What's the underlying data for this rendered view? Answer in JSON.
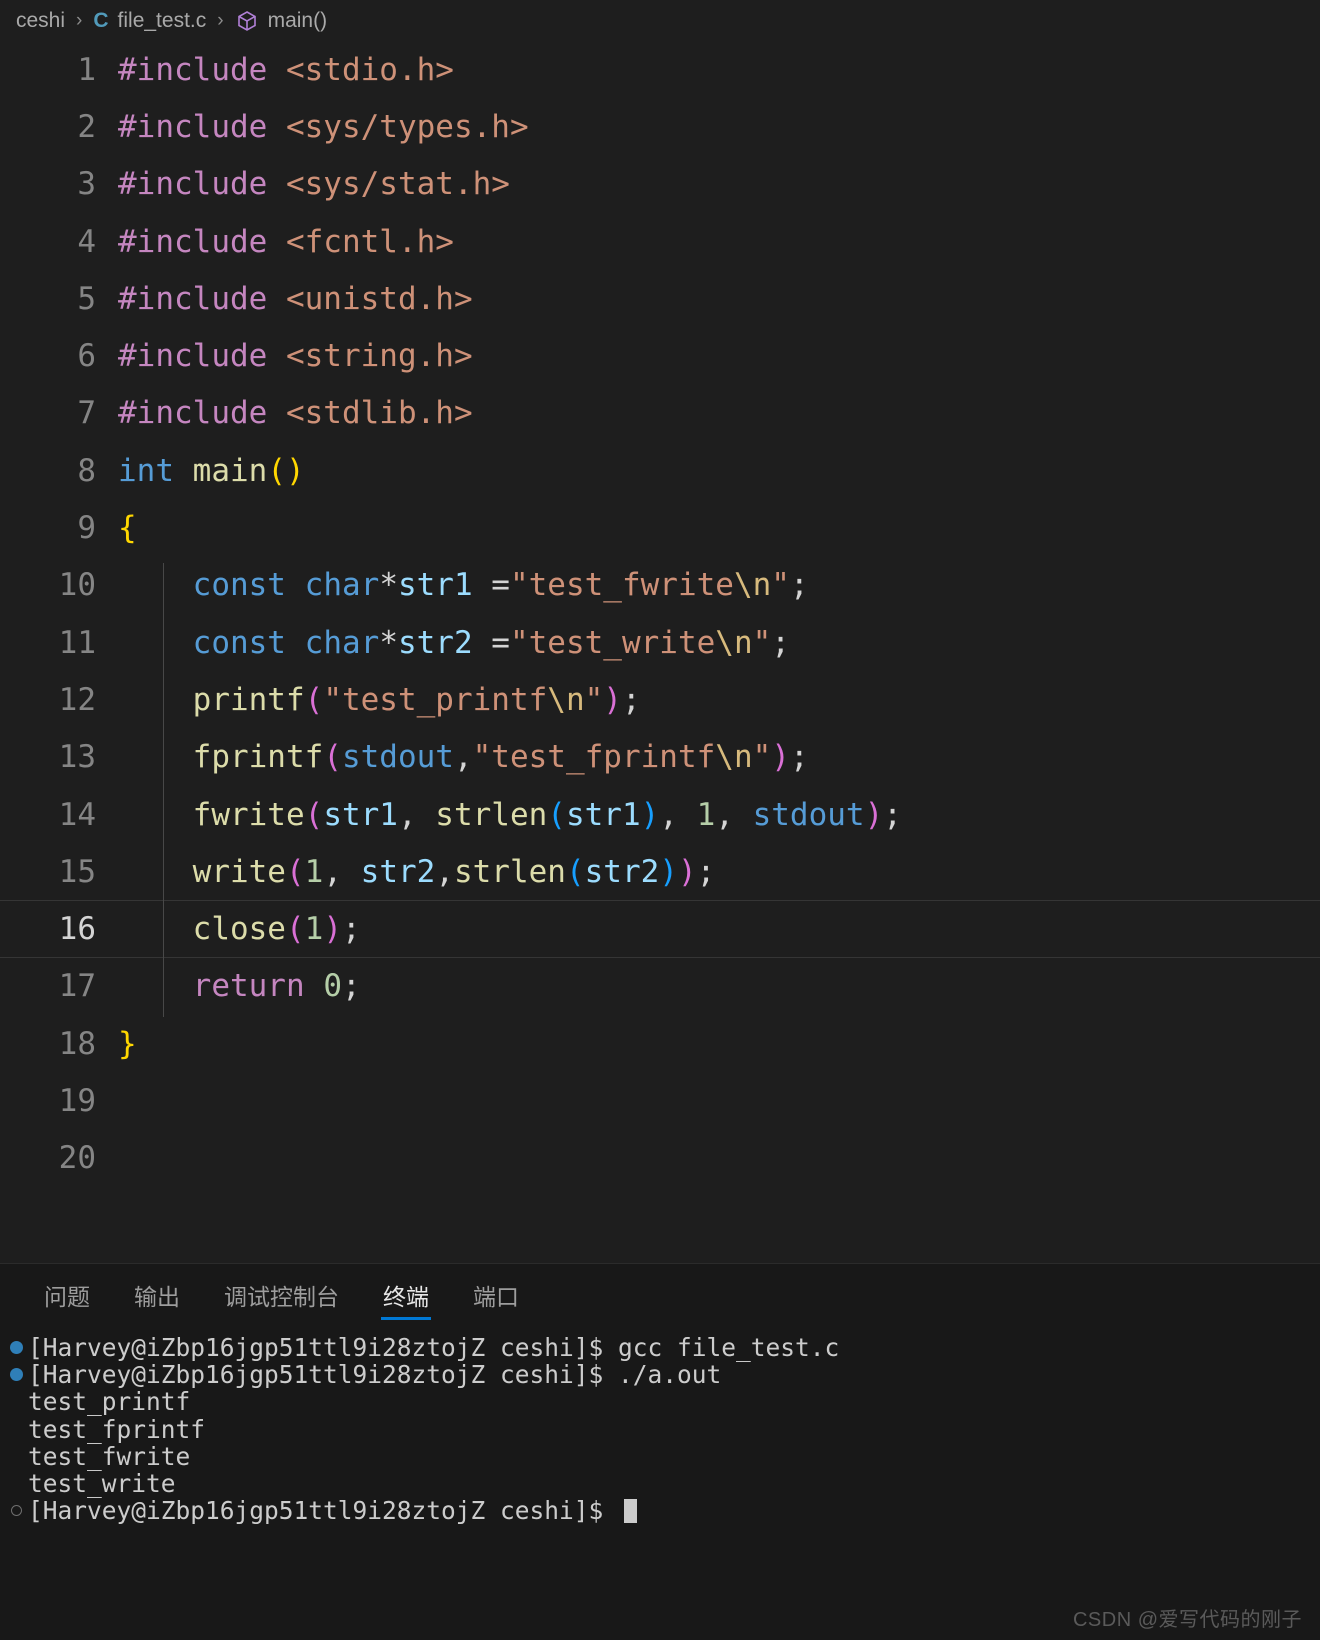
{
  "breadcrumb": {
    "items": [
      {
        "label": "ceshi",
        "icon": null
      },
      {
        "label": "file_test.c",
        "icon": "c-file-icon"
      },
      {
        "label": "main()",
        "icon": "symbol-cube-icon"
      }
    ],
    "separator": "›"
  },
  "editor": {
    "active_line": 16,
    "total_lines": 20,
    "lines": [
      {
        "n": "1",
        "tokens": [
          {
            "t": "#include",
            "c": "t-pre"
          },
          {
            "t": " ",
            "c": "t-plain"
          },
          {
            "t": "<stdio.h>",
            "c": "t-str"
          }
        ]
      },
      {
        "n": "2",
        "tokens": [
          {
            "t": "#include",
            "c": "t-pre"
          },
          {
            "t": " ",
            "c": "t-plain"
          },
          {
            "t": "<sys/types.h>",
            "c": "t-str"
          }
        ]
      },
      {
        "n": "3",
        "tokens": [
          {
            "t": "#include",
            "c": "t-pre"
          },
          {
            "t": " ",
            "c": "t-plain"
          },
          {
            "t": "<sys/stat.h>",
            "c": "t-str"
          }
        ]
      },
      {
        "n": "4",
        "tokens": [
          {
            "t": "#include",
            "c": "t-pre"
          },
          {
            "t": " ",
            "c": "t-plain"
          },
          {
            "t": "<fcntl.h>",
            "c": "t-str"
          }
        ]
      },
      {
        "n": "5",
        "tokens": [
          {
            "t": "#include",
            "c": "t-pre"
          },
          {
            "t": " ",
            "c": "t-plain"
          },
          {
            "t": "<unistd.h>",
            "c": "t-str"
          }
        ]
      },
      {
        "n": "6",
        "tokens": [
          {
            "t": "#include",
            "c": "t-pre"
          },
          {
            "t": " ",
            "c": "t-plain"
          },
          {
            "t": "<string.h>",
            "c": "t-str"
          }
        ]
      },
      {
        "n": "7",
        "tokens": [
          {
            "t": "#include",
            "c": "t-pre"
          },
          {
            "t": " ",
            "c": "t-plain"
          },
          {
            "t": "<stdlib.h>",
            "c": "t-str"
          }
        ]
      },
      {
        "n": "8",
        "tokens": [
          {
            "t": "int",
            "c": "t-key"
          },
          {
            "t": " ",
            "c": "t-plain"
          },
          {
            "t": "main",
            "c": "t-fn"
          },
          {
            "t": "()",
            "c": "t-br1"
          }
        ]
      },
      {
        "n": "9",
        "tokens": [
          {
            "t": "{",
            "c": "t-br1"
          }
        ]
      },
      {
        "n": "10",
        "tokens": [
          {
            "t": "    ",
            "c": "t-plain"
          },
          {
            "t": "const",
            "c": "t-key"
          },
          {
            "t": " ",
            "c": "t-plain"
          },
          {
            "t": "char",
            "c": "t-key"
          },
          {
            "t": "*",
            "c": "t-plain"
          },
          {
            "t": "str1",
            "c": "t-var"
          },
          {
            "t": " =",
            "c": "t-plain"
          },
          {
            "t": "\"test_fwrite",
            "c": "t-str"
          },
          {
            "t": "\\n",
            "c": "t-esc"
          },
          {
            "t": "\"",
            "c": "t-str"
          },
          {
            "t": ";",
            "c": "t-plain"
          }
        ]
      },
      {
        "n": "11",
        "tokens": [
          {
            "t": "    ",
            "c": "t-plain"
          },
          {
            "t": "const",
            "c": "t-key"
          },
          {
            "t": " ",
            "c": "t-plain"
          },
          {
            "t": "char",
            "c": "t-key"
          },
          {
            "t": "*",
            "c": "t-plain"
          },
          {
            "t": "str2",
            "c": "t-var"
          },
          {
            "t": " =",
            "c": "t-plain"
          },
          {
            "t": "\"test_write",
            "c": "t-str"
          },
          {
            "t": "\\n",
            "c": "t-esc"
          },
          {
            "t": "\"",
            "c": "t-str"
          },
          {
            "t": ";",
            "c": "t-plain"
          }
        ]
      },
      {
        "n": "12",
        "tokens": [
          {
            "t": "    ",
            "c": "t-plain"
          },
          {
            "t": "printf",
            "c": "t-fn"
          },
          {
            "t": "(",
            "c": "t-br2"
          },
          {
            "t": "\"test_printf",
            "c": "t-str"
          },
          {
            "t": "\\n",
            "c": "t-esc"
          },
          {
            "t": "\"",
            "c": "t-str"
          },
          {
            "t": ")",
            "c": "t-br2"
          },
          {
            "t": ";",
            "c": "t-plain"
          }
        ]
      },
      {
        "n": "13",
        "tokens": [
          {
            "t": "    ",
            "c": "t-plain"
          },
          {
            "t": "fprintf",
            "c": "t-fn"
          },
          {
            "t": "(",
            "c": "t-br2"
          },
          {
            "t": "stdout",
            "c": "t-key"
          },
          {
            "t": ",",
            "c": "t-plain"
          },
          {
            "t": "\"test_fprintf",
            "c": "t-str"
          },
          {
            "t": "\\n",
            "c": "t-esc"
          },
          {
            "t": "\"",
            "c": "t-str"
          },
          {
            "t": ")",
            "c": "t-br2"
          },
          {
            "t": ";",
            "c": "t-plain"
          }
        ]
      },
      {
        "n": "14",
        "tokens": [
          {
            "t": "    ",
            "c": "t-plain"
          },
          {
            "t": "fwrite",
            "c": "t-fn"
          },
          {
            "t": "(",
            "c": "t-br2"
          },
          {
            "t": "str1",
            "c": "t-var"
          },
          {
            "t": ", ",
            "c": "t-plain"
          },
          {
            "t": "strlen",
            "c": "t-fn"
          },
          {
            "t": "(",
            "c": "t-br3"
          },
          {
            "t": "str1",
            "c": "t-var"
          },
          {
            "t": ")",
            "c": "t-br3"
          },
          {
            "t": ", ",
            "c": "t-plain"
          },
          {
            "t": "1",
            "c": "t-num"
          },
          {
            "t": ", ",
            "c": "t-plain"
          },
          {
            "t": "stdout",
            "c": "t-key"
          },
          {
            "t": ")",
            "c": "t-br2"
          },
          {
            "t": ";",
            "c": "t-plain"
          }
        ]
      },
      {
        "n": "15",
        "tokens": [
          {
            "t": "    ",
            "c": "t-plain"
          },
          {
            "t": "write",
            "c": "t-fn"
          },
          {
            "t": "(",
            "c": "t-br2"
          },
          {
            "t": "1",
            "c": "t-num"
          },
          {
            "t": ", ",
            "c": "t-plain"
          },
          {
            "t": "str2",
            "c": "t-var"
          },
          {
            "t": ",",
            "c": "t-plain"
          },
          {
            "t": "strlen",
            "c": "t-fn"
          },
          {
            "t": "(",
            "c": "t-br3"
          },
          {
            "t": "str2",
            "c": "t-var"
          },
          {
            "t": ")",
            "c": "t-br3"
          },
          {
            "t": ")",
            "c": "t-br2"
          },
          {
            "t": ";",
            "c": "t-plain"
          }
        ]
      },
      {
        "n": "16",
        "tokens": [
          {
            "t": "    ",
            "c": "t-plain"
          },
          {
            "t": "close",
            "c": "t-fn"
          },
          {
            "t": "(",
            "c": "t-br2"
          },
          {
            "t": "1",
            "c": "t-num"
          },
          {
            "t": ")",
            "c": "t-br2"
          },
          {
            "t": ";",
            "c": "t-plain"
          }
        ]
      },
      {
        "n": "17",
        "tokens": [
          {
            "t": "    ",
            "c": "t-plain"
          },
          {
            "t": "return",
            "c": "t-pre"
          },
          {
            "t": " ",
            "c": "t-plain"
          },
          {
            "t": "0",
            "c": "t-num"
          },
          {
            "t": ";",
            "c": "t-plain"
          }
        ]
      },
      {
        "n": "18",
        "tokens": [
          {
            "t": "}",
            "c": "t-br1"
          }
        ]
      },
      {
        "n": "19",
        "tokens": []
      },
      {
        "n": "20",
        "tokens": []
      }
    ]
  },
  "panel": {
    "tabs": [
      {
        "label": "问题",
        "active": false
      },
      {
        "label": "输出",
        "active": false
      },
      {
        "label": "调试控制台",
        "active": false
      },
      {
        "label": "终端",
        "active": true
      },
      {
        "label": "端口",
        "active": false
      }
    ],
    "accent_color": "#0078d4"
  },
  "terminal": {
    "prompt": "[Harvey@iZbp16jgp51ttl9i28ztojZ ceshi]$",
    "lines": [
      {
        "marker": "filled",
        "text": "[Harvey@iZbp16jgp51ttl9i28ztojZ ceshi]$ gcc file_test.c",
        "cursor": false
      },
      {
        "marker": "filled",
        "text": "[Harvey@iZbp16jgp51ttl9i28ztojZ ceshi]$ ./a.out",
        "cursor": false
      },
      {
        "marker": "none",
        "text": "test_printf",
        "cursor": false
      },
      {
        "marker": "none",
        "text": "test_fprintf",
        "cursor": false
      },
      {
        "marker": "none",
        "text": "test_fwrite",
        "cursor": false
      },
      {
        "marker": "none",
        "text": "test_write",
        "cursor": false
      },
      {
        "marker": "hollow",
        "text": "[Harvey@iZbp16jgp51ttl9i28ztojZ ceshi]$ ",
        "cursor": true
      }
    ]
  },
  "watermark": {
    "text": "CSDN @爱写代码的刚子"
  }
}
